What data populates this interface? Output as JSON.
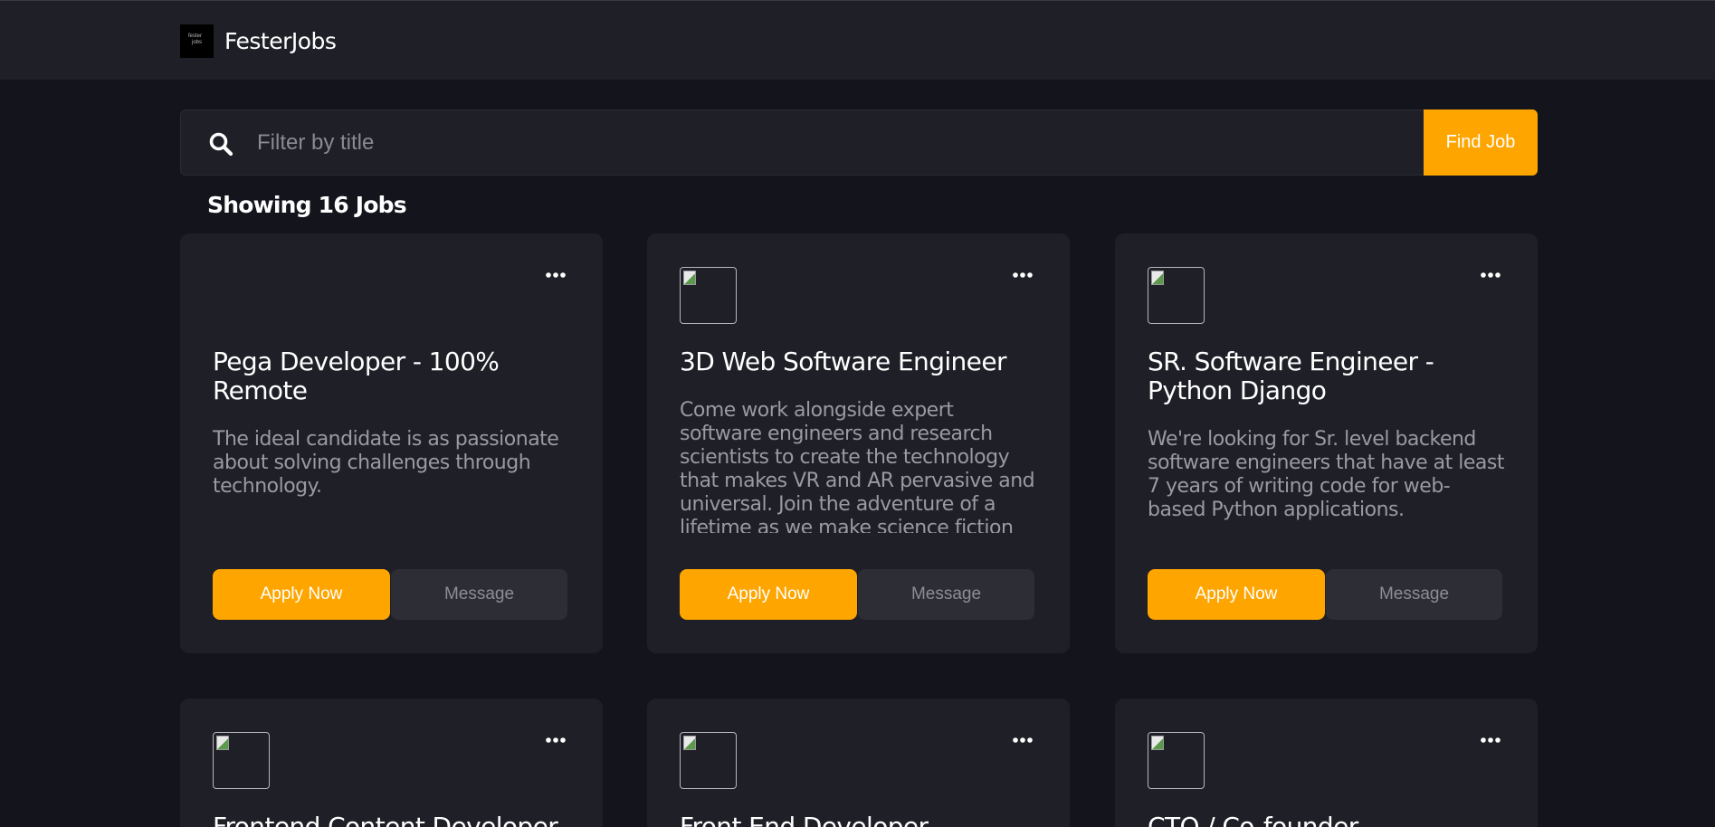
{
  "header": {
    "brand": "FesterJobs",
    "logo_line1": "fester",
    "logo_line2": "jobs"
  },
  "search": {
    "placeholder": "Filter by title",
    "value": "",
    "button_label": "Find Job"
  },
  "results": {
    "count_label": "Showing 16 Jobs"
  },
  "jobs": [
    {
      "title": "Pega Developer - 100% Remote",
      "description": "The ideal candidate is as passionate about solving challenges through technology.",
      "apply_label": "Apply Now",
      "message_label": "Message"
    },
    {
      "title": "3D Web Software Engineer",
      "description": "Come work alongside expert software engineers and research scientists to create the technology that makes VR and AR pervasive and universal. Join the adventure of a lifetime as we make science fiction",
      "apply_label": "Apply Now",
      "message_label": "Message"
    },
    {
      "title": "SR. Software Engineer - Python Django",
      "description": "We're looking for Sr. level backend software engineers that have at least 7 years of writing code for web-based Python applications.",
      "apply_label": "Apply Now",
      "message_label": "Message"
    },
    {
      "title": "Frontend Content Developer"
    },
    {
      "title": "Front End Developer"
    },
    {
      "title": "CTO / Co-founder"
    }
  ],
  "icons": {
    "search": "search-icon",
    "more": "more-options-icon",
    "logo": "company-logo"
  },
  "colors": {
    "accent": "#ffa500",
    "background": "#13141c",
    "surface": "#1e1f27",
    "header": "#1f2027"
  }
}
